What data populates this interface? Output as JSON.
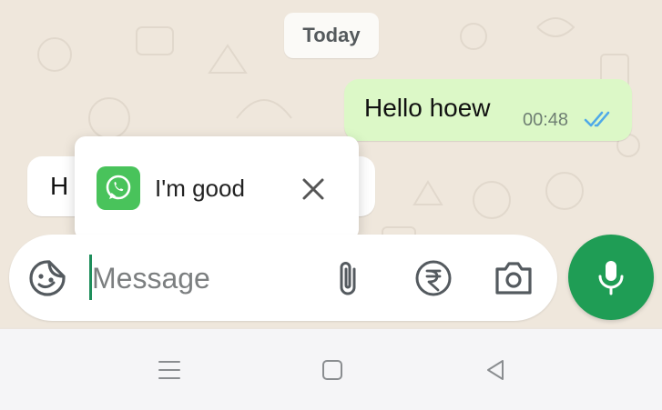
{
  "chat": {
    "date_label": "Today",
    "messages": [
      {
        "direction": "outgoing",
        "text": "Hello hoew",
        "time": "00:48",
        "status": "read"
      },
      {
        "direction": "incoming",
        "text": "H"
      }
    ]
  },
  "reply_popup": {
    "app_icon": "whatsapp-icon",
    "suggestion": "I'm good",
    "close_icon": "close-icon"
  },
  "composer": {
    "placeholder": "Message",
    "value": "",
    "icons": [
      "sticker-icon",
      "attach-icon",
      "rupee-payment-icon",
      "camera-icon",
      "mic-icon"
    ]
  },
  "nav": {
    "icons": [
      "menu-icon",
      "home-icon",
      "back-icon"
    ]
  },
  "colors": {
    "accent": "#1f9d55",
    "outgoing_bubble": "#dcf8c7",
    "read_ticks": "#4fa9e8",
    "chat_background": "#efe7dc"
  }
}
